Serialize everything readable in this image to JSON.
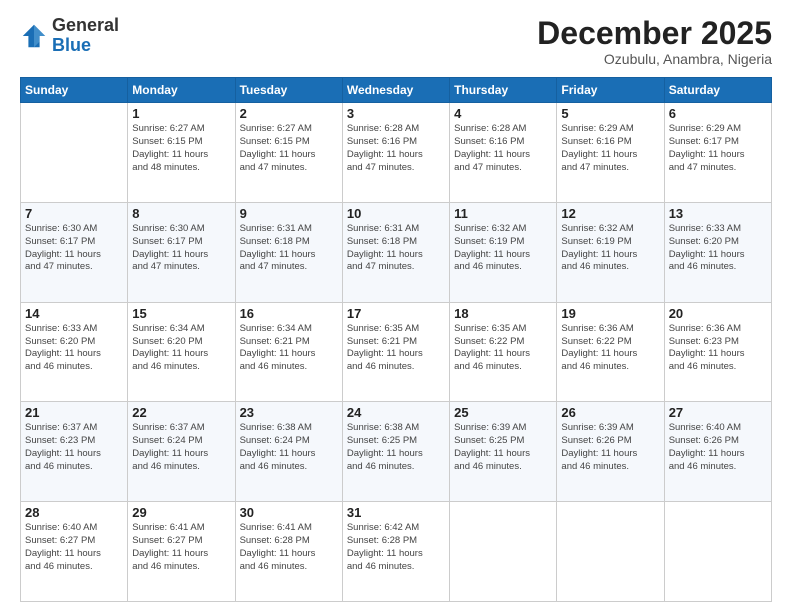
{
  "header": {
    "logo": {
      "general": "General",
      "blue": "Blue"
    },
    "title": "December 2025",
    "subtitle": "Ozubulu, Anambra, Nigeria"
  },
  "calendar": {
    "days_of_week": [
      "Sunday",
      "Monday",
      "Tuesday",
      "Wednesday",
      "Thursday",
      "Friday",
      "Saturday"
    ],
    "weeks": [
      [
        {
          "day": "",
          "info": ""
        },
        {
          "day": "1",
          "info": "Sunrise: 6:27 AM\nSunset: 6:15 PM\nDaylight: 11 hours\nand 48 minutes."
        },
        {
          "day": "2",
          "info": "Sunrise: 6:27 AM\nSunset: 6:15 PM\nDaylight: 11 hours\nand 47 minutes."
        },
        {
          "day": "3",
          "info": "Sunrise: 6:28 AM\nSunset: 6:16 PM\nDaylight: 11 hours\nand 47 minutes."
        },
        {
          "day": "4",
          "info": "Sunrise: 6:28 AM\nSunset: 6:16 PM\nDaylight: 11 hours\nand 47 minutes."
        },
        {
          "day": "5",
          "info": "Sunrise: 6:29 AM\nSunset: 6:16 PM\nDaylight: 11 hours\nand 47 minutes."
        },
        {
          "day": "6",
          "info": "Sunrise: 6:29 AM\nSunset: 6:17 PM\nDaylight: 11 hours\nand 47 minutes."
        }
      ],
      [
        {
          "day": "7",
          "info": "Sunrise: 6:30 AM\nSunset: 6:17 PM\nDaylight: 11 hours\nand 47 minutes."
        },
        {
          "day": "8",
          "info": "Sunrise: 6:30 AM\nSunset: 6:17 PM\nDaylight: 11 hours\nand 47 minutes."
        },
        {
          "day": "9",
          "info": "Sunrise: 6:31 AM\nSunset: 6:18 PM\nDaylight: 11 hours\nand 47 minutes."
        },
        {
          "day": "10",
          "info": "Sunrise: 6:31 AM\nSunset: 6:18 PM\nDaylight: 11 hours\nand 47 minutes."
        },
        {
          "day": "11",
          "info": "Sunrise: 6:32 AM\nSunset: 6:19 PM\nDaylight: 11 hours\nand 46 minutes."
        },
        {
          "day": "12",
          "info": "Sunrise: 6:32 AM\nSunset: 6:19 PM\nDaylight: 11 hours\nand 46 minutes."
        },
        {
          "day": "13",
          "info": "Sunrise: 6:33 AM\nSunset: 6:20 PM\nDaylight: 11 hours\nand 46 minutes."
        }
      ],
      [
        {
          "day": "14",
          "info": "Sunrise: 6:33 AM\nSunset: 6:20 PM\nDaylight: 11 hours\nand 46 minutes."
        },
        {
          "day": "15",
          "info": "Sunrise: 6:34 AM\nSunset: 6:20 PM\nDaylight: 11 hours\nand 46 minutes."
        },
        {
          "day": "16",
          "info": "Sunrise: 6:34 AM\nSunset: 6:21 PM\nDaylight: 11 hours\nand 46 minutes."
        },
        {
          "day": "17",
          "info": "Sunrise: 6:35 AM\nSunset: 6:21 PM\nDaylight: 11 hours\nand 46 minutes."
        },
        {
          "day": "18",
          "info": "Sunrise: 6:35 AM\nSunset: 6:22 PM\nDaylight: 11 hours\nand 46 minutes."
        },
        {
          "day": "19",
          "info": "Sunrise: 6:36 AM\nSunset: 6:22 PM\nDaylight: 11 hours\nand 46 minutes."
        },
        {
          "day": "20",
          "info": "Sunrise: 6:36 AM\nSunset: 6:23 PM\nDaylight: 11 hours\nand 46 minutes."
        }
      ],
      [
        {
          "day": "21",
          "info": "Sunrise: 6:37 AM\nSunset: 6:23 PM\nDaylight: 11 hours\nand 46 minutes."
        },
        {
          "day": "22",
          "info": "Sunrise: 6:37 AM\nSunset: 6:24 PM\nDaylight: 11 hours\nand 46 minutes."
        },
        {
          "day": "23",
          "info": "Sunrise: 6:38 AM\nSunset: 6:24 PM\nDaylight: 11 hours\nand 46 minutes."
        },
        {
          "day": "24",
          "info": "Sunrise: 6:38 AM\nSunset: 6:25 PM\nDaylight: 11 hours\nand 46 minutes."
        },
        {
          "day": "25",
          "info": "Sunrise: 6:39 AM\nSunset: 6:25 PM\nDaylight: 11 hours\nand 46 minutes."
        },
        {
          "day": "26",
          "info": "Sunrise: 6:39 AM\nSunset: 6:26 PM\nDaylight: 11 hours\nand 46 minutes."
        },
        {
          "day": "27",
          "info": "Sunrise: 6:40 AM\nSunset: 6:26 PM\nDaylight: 11 hours\nand 46 minutes."
        }
      ],
      [
        {
          "day": "28",
          "info": "Sunrise: 6:40 AM\nSunset: 6:27 PM\nDaylight: 11 hours\nand 46 minutes."
        },
        {
          "day": "29",
          "info": "Sunrise: 6:41 AM\nSunset: 6:27 PM\nDaylight: 11 hours\nand 46 minutes."
        },
        {
          "day": "30",
          "info": "Sunrise: 6:41 AM\nSunset: 6:28 PM\nDaylight: 11 hours\nand 46 minutes."
        },
        {
          "day": "31",
          "info": "Sunrise: 6:42 AM\nSunset: 6:28 PM\nDaylight: 11 hours\nand 46 minutes."
        },
        {
          "day": "",
          "info": ""
        },
        {
          "day": "",
          "info": ""
        },
        {
          "day": "",
          "info": ""
        }
      ]
    ]
  }
}
